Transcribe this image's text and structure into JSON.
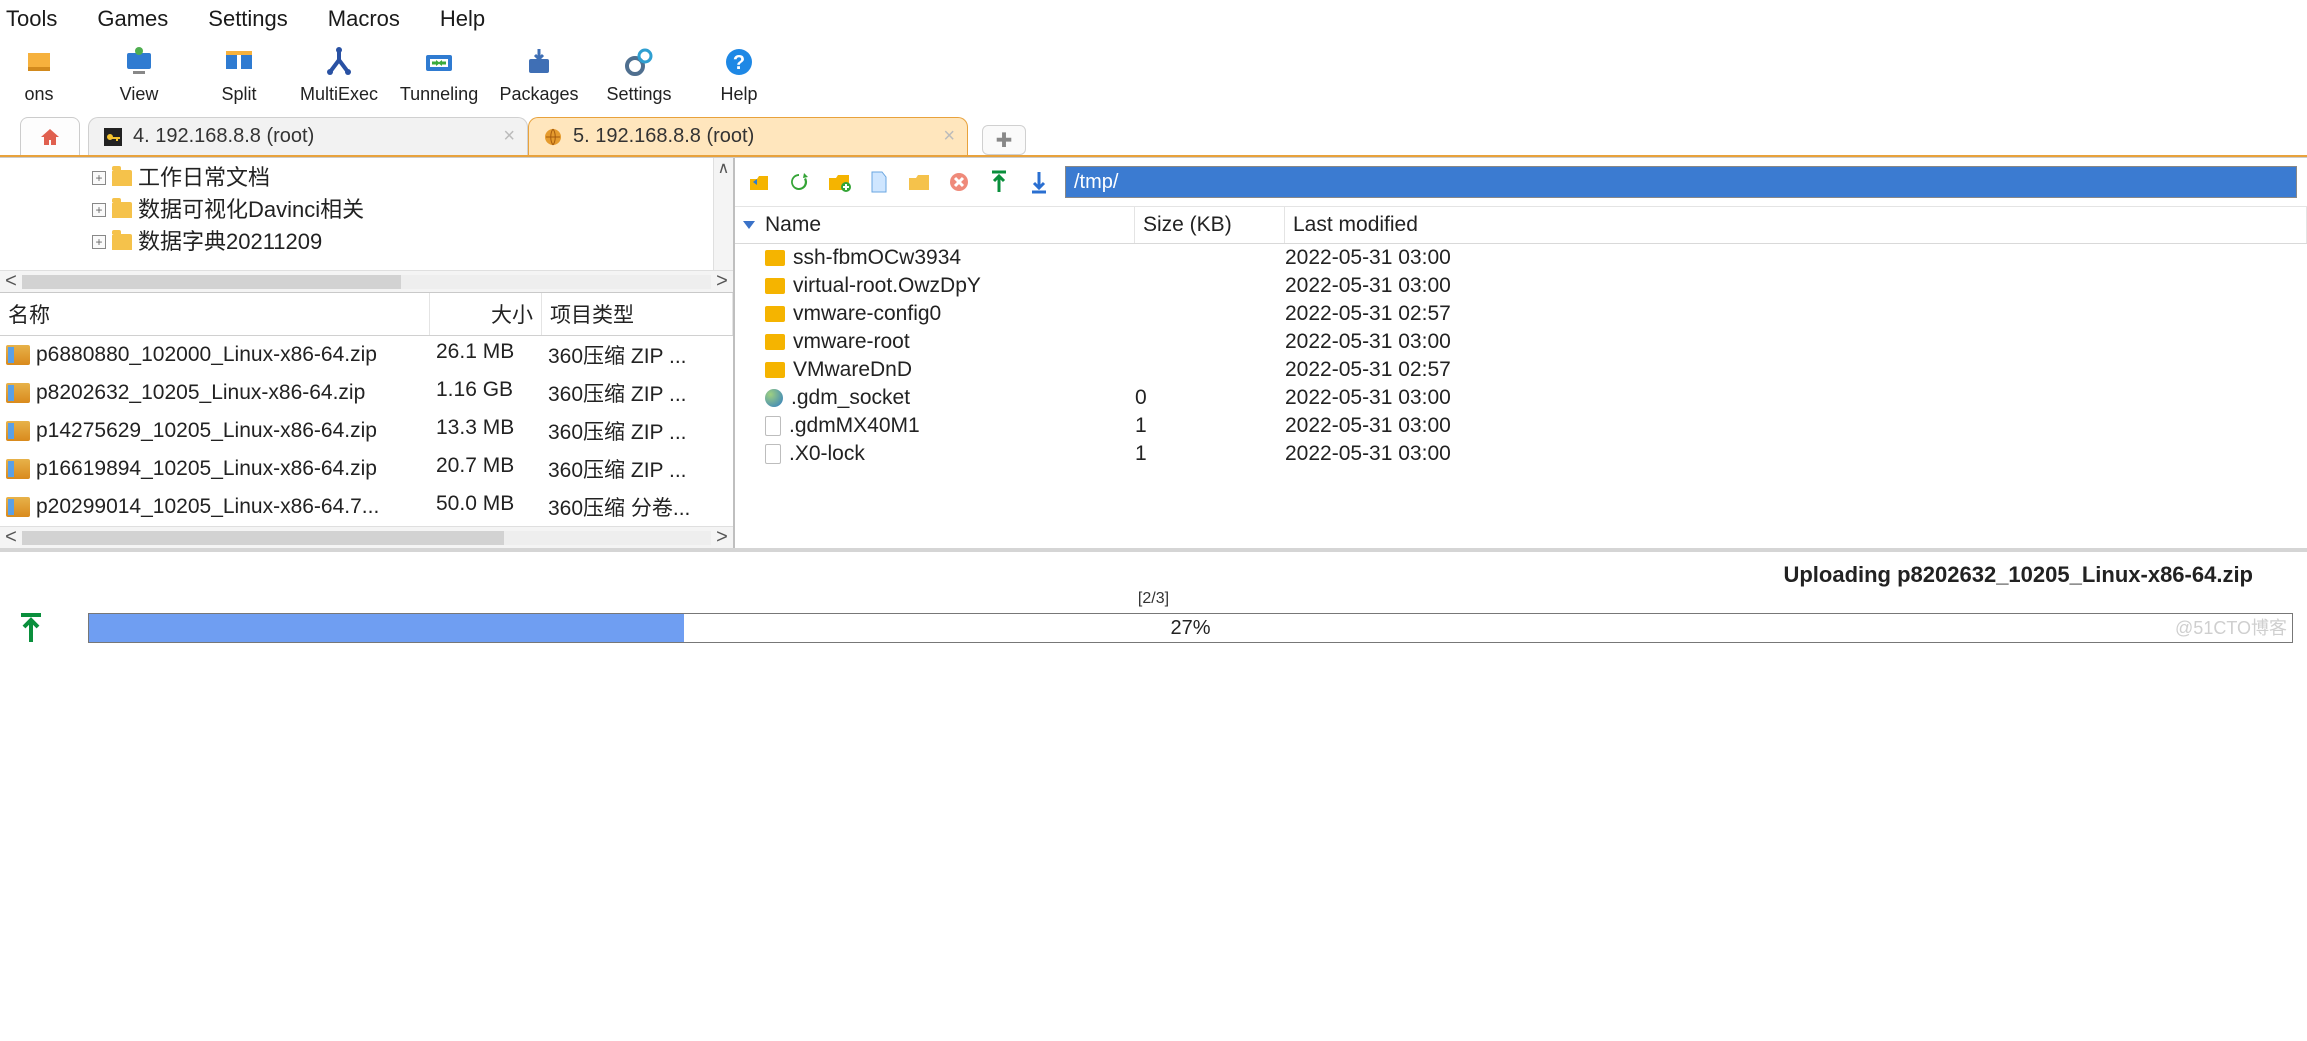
{
  "menu": {
    "items": [
      "Tools",
      "Games",
      "Settings",
      "Macros",
      "Help"
    ]
  },
  "toolbar": [
    {
      "id": "sessions",
      "label": "ons"
    },
    {
      "id": "view",
      "label": "View"
    },
    {
      "id": "split",
      "label": "Split"
    },
    {
      "id": "multiexec",
      "label": "MultiExec"
    },
    {
      "id": "tunneling",
      "label": "Tunneling"
    },
    {
      "id": "packages",
      "label": "Packages"
    },
    {
      "id": "settings",
      "label": "Settings"
    },
    {
      "id": "help",
      "label": "Help"
    }
  ],
  "tabs": {
    "t1": {
      "label": "4. 192.168.8.8 (root)"
    },
    "t2": {
      "label": "5. 192.168.8.8 (root)"
    }
  },
  "left": {
    "tree": [
      {
        "label": "工作日常文档"
      },
      {
        "label": "数据可视化Davinci相关"
      },
      {
        "label": "数据字典20211209"
      }
    ],
    "headers": {
      "name": "名称",
      "size": "大小",
      "type": "项目类型"
    },
    "files": [
      {
        "name": "p6880880_102000_Linux-x86-64.zip",
        "size": "26.1 MB",
        "type": "360压缩 ZIP ..."
      },
      {
        "name": "p8202632_10205_Linux-x86-64.zip",
        "size": "1.16 GB",
        "type": "360压缩 ZIP ..."
      },
      {
        "name": "p14275629_10205_Linux-x86-64.zip",
        "size": "13.3 MB",
        "type": "360压缩 ZIP ..."
      },
      {
        "name": "p16619894_10205_Linux-x86-64.zip",
        "size": "20.7 MB",
        "type": "360压缩 ZIP ..."
      },
      {
        "name": "p20299014_10205_Linux-x86-64.7...",
        "size": "50.0 MB",
        "type": "360压缩 分卷..."
      }
    ]
  },
  "right": {
    "path": "/tmp/",
    "headers": {
      "name": "Name",
      "size": "Size (KB)",
      "modified": "Last modified"
    },
    "files": [
      {
        "icon": "folder",
        "name": "ssh-fbmOCw3934",
        "size": "",
        "modified": "2022-05-31 03:00"
      },
      {
        "icon": "folder",
        "name": "virtual-root.OwzDpY",
        "size": "",
        "modified": "2022-05-31 03:00"
      },
      {
        "icon": "folder",
        "name": "vmware-config0",
        "size": "",
        "modified": "2022-05-31 02:57"
      },
      {
        "icon": "folder",
        "name": "vmware-root",
        "size": "",
        "modified": "2022-05-31 03:00"
      },
      {
        "icon": "folder",
        "name": "VMwareDnD",
        "size": "",
        "modified": "2022-05-31 02:57"
      },
      {
        "icon": "globe",
        "name": ".gdm_socket",
        "size": "0",
        "modified": "2022-05-31 03:00"
      },
      {
        "icon": "file",
        "name": ".gdmMX40M1",
        "size": "1",
        "modified": "2022-05-31 03:00"
      },
      {
        "icon": "file",
        "name": ".X0-lock",
        "size": "1",
        "modified": "2022-05-31 03:00"
      }
    ]
  },
  "upload": {
    "label": "Uploading p8202632_10205_Linux-x86-64.zip",
    "count": "[2/3]",
    "percent_text": "27%",
    "percent": 27
  },
  "watermark": "@51CTO博客"
}
